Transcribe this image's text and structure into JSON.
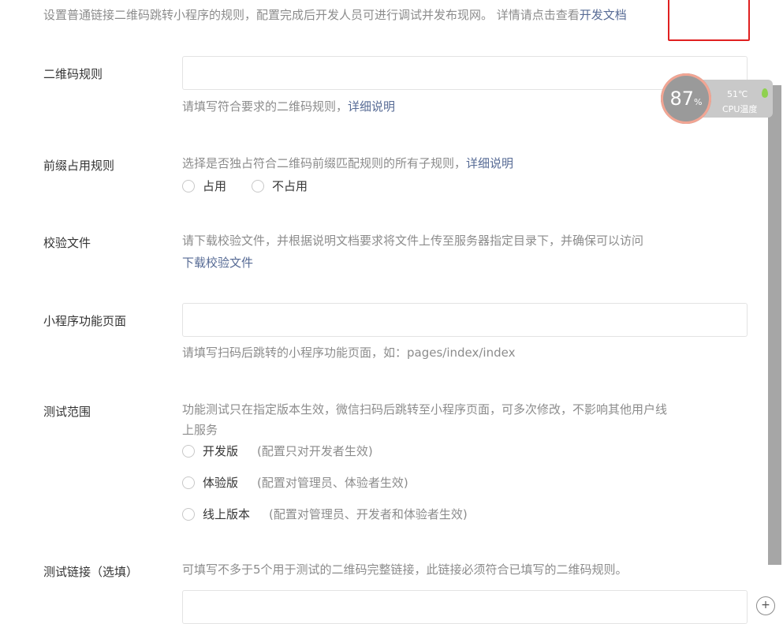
{
  "intro": {
    "text": "设置普通链接二维码跳转小程序的规则，配置完成后开发人员可进行调试并发布现网。 详情请点击查看",
    "link": "开发文档"
  },
  "fields": {
    "qr_rule": {
      "label": "二维码规则",
      "value": "",
      "tip": "请填写符合要求的二维码规则，",
      "tip_link": "详细说明"
    },
    "prefix_rule": {
      "label": "前缀占用规则",
      "tip": "选择是否独占符合二维码前缀匹配规则的所有子规则，",
      "tip_link": "详细说明",
      "options": [
        "占用",
        "不占用"
      ]
    },
    "verify_file": {
      "label": "校验文件",
      "tip": "请下载校验文件，并根据说明文档要求将文件上传至服务器指定目录下，并确保可以访问",
      "link": "下载校验文件"
    },
    "page": {
      "label": "小程序功能页面",
      "value": "",
      "tip": "请填写扫码后跳转的小程序功能页面，如：pages/index/index"
    },
    "test_scope": {
      "label": "测试范围",
      "tip_line1": "功能测试只在指定版本生效，微信扫码后跳转至小程序页面，可多次修改，不影响其他用户线",
      "tip_line2": "上服务",
      "options": [
        {
          "label": "开发版",
          "desc": "(配置只对开发者生效)"
        },
        {
          "label": "体验版",
          "desc": "(配置对管理员、体验者生效)"
        },
        {
          "label": "线上版本",
          "desc": "(配置对管理员、开发者和体验者生效)"
        }
      ]
    },
    "test_link": {
      "label": "测试链接（选填）",
      "tip": "可填写不多于5个用于测试的二维码完整链接，此链接必须符合已填写的二维码规则。",
      "value": ""
    }
  },
  "cpu_widget": {
    "percent": "87",
    "percent_unit": "%",
    "temperature": "51℃",
    "caption": "CPU温度"
  },
  "plus_button_label": "+"
}
